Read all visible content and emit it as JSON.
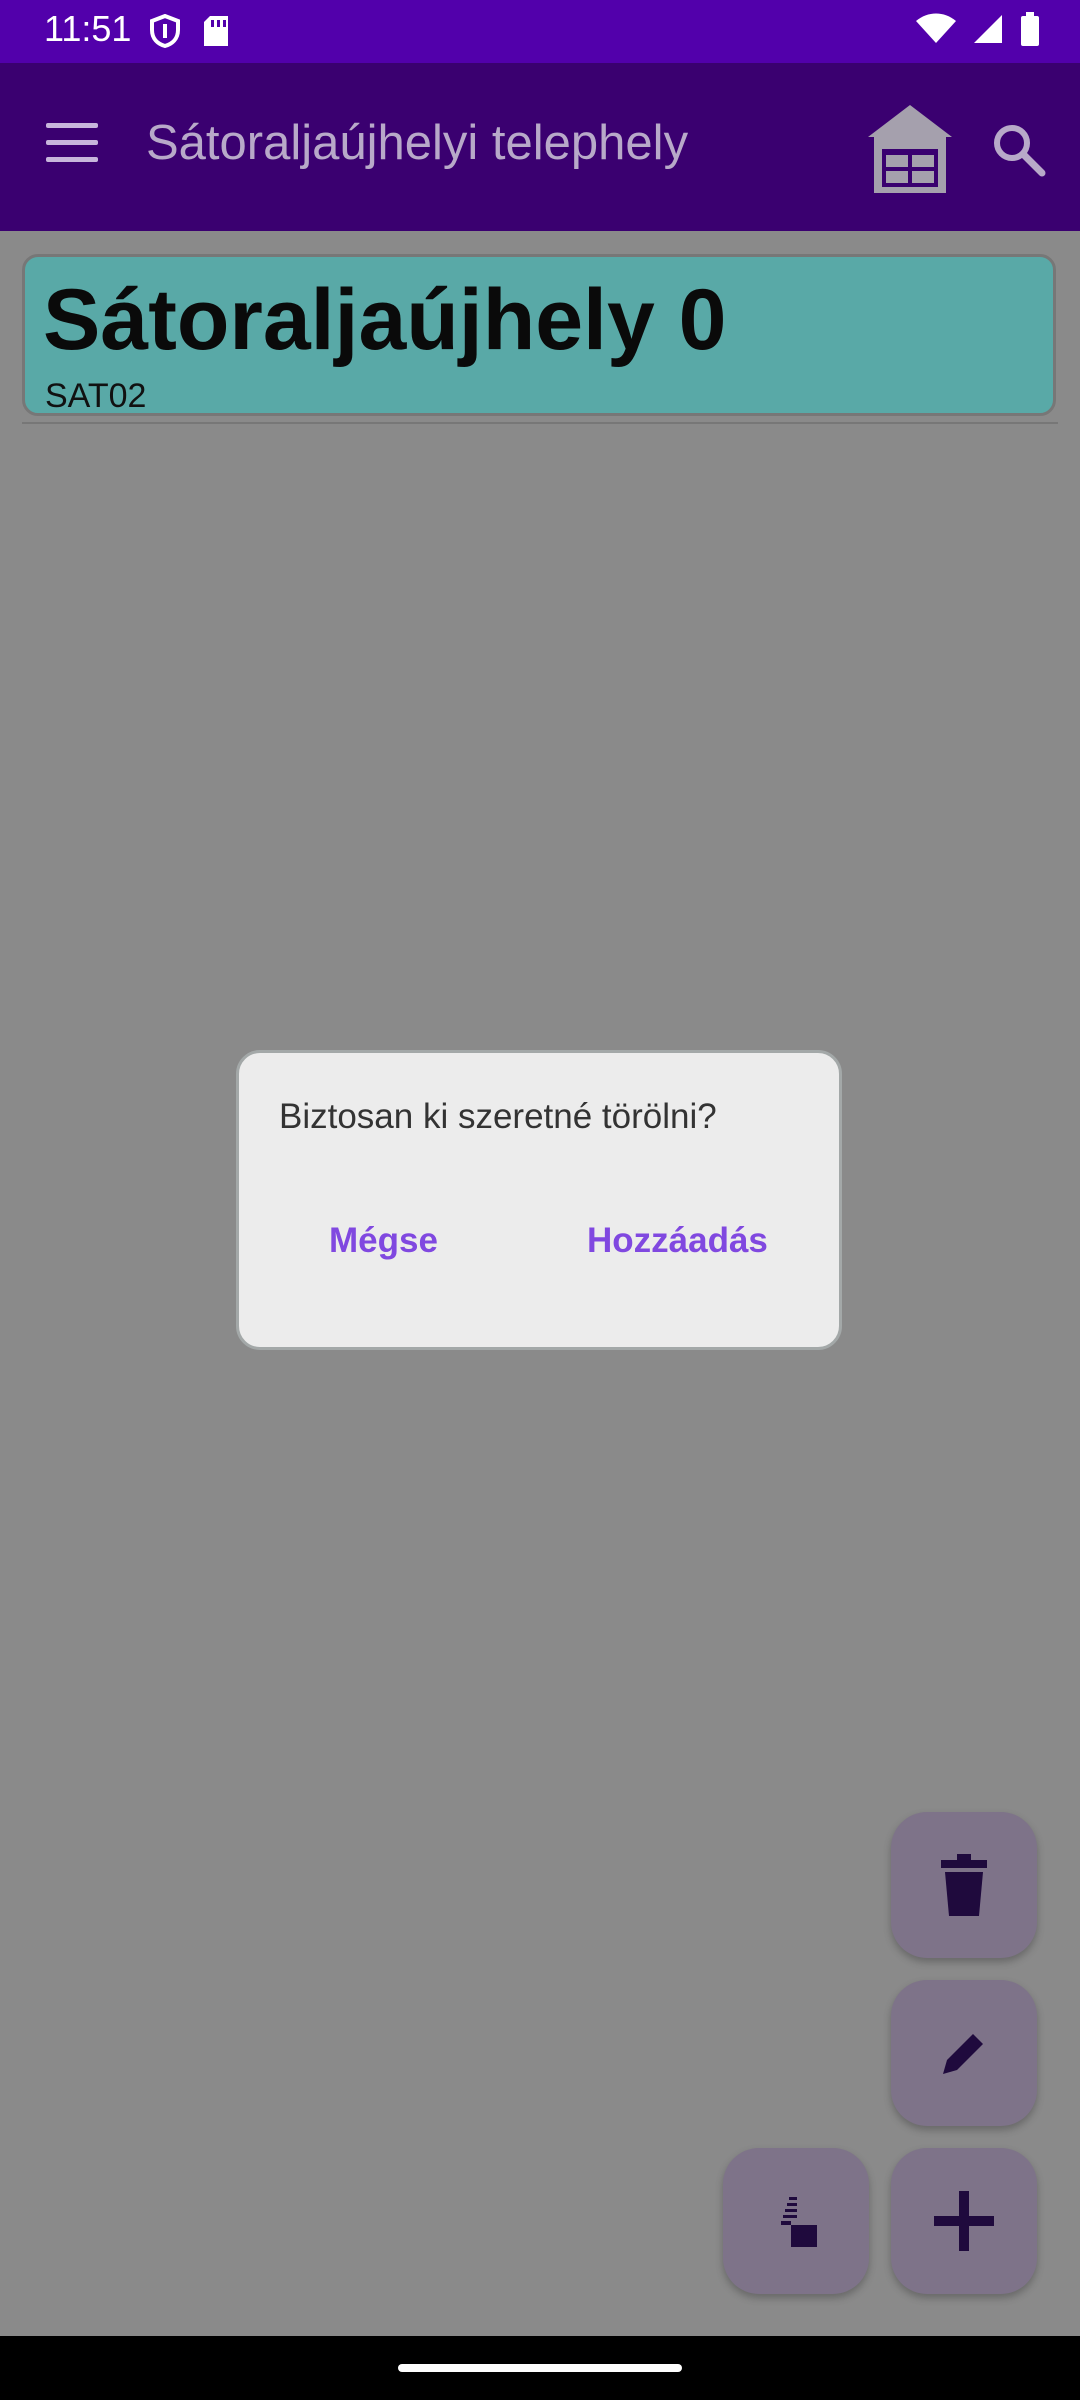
{
  "status_bar": {
    "time": "11:51",
    "icons_left": [
      "shield-icon",
      "sd-card-icon"
    ],
    "icons_right": [
      "wifi-icon",
      "signal-icon",
      "battery-icon"
    ]
  },
  "app_bar": {
    "title": "Sátoraljaújhelyi telephely",
    "icons": [
      "menu-icon",
      "warehouse-icon",
      "search-icon"
    ]
  },
  "card": {
    "title": "Sátoraljaújhely 0",
    "code": "SAT02"
  },
  "dialog": {
    "message": "Biztosan ki szeretné törölni?",
    "cancel_label": "Mégse",
    "confirm_label": "Hozzáadás"
  },
  "fabs": [
    "delete-icon",
    "edit-icon",
    "stack-icon",
    "add-icon"
  ],
  "colors": {
    "status_bar": "#5200ab",
    "app_bar": "#3a0070",
    "card": "#59a9a7",
    "scrim": "#8a8a8a",
    "dialog_button": "#8048e0",
    "fab": "#7e7389"
  }
}
